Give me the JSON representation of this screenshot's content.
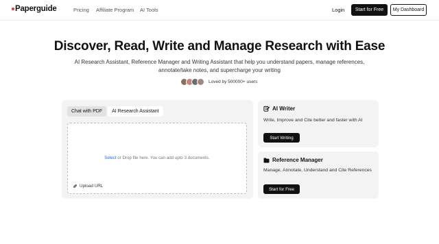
{
  "nav": {
    "logo": "Paperguide",
    "links": [
      "Pricing",
      "Affiliate Program",
      "AI Tools"
    ],
    "login": "Login",
    "start_free": "Start for Free",
    "dashboard": "My Dashboard"
  },
  "hero": {
    "title": "Discover, Read, Write and Manage Research with Ease",
    "subtitle": "AI Research Assistant, Reference Manager and Writing Assistant that help you understand papers, manage references, annotate/take notes, and supercharge your writing",
    "loved": "Loved by 500000+ users"
  },
  "upload_card": {
    "tabs": [
      "Chat with PDF",
      "AI Research Assistant"
    ],
    "select_link": "Select",
    "drop_text": "or Drop file here. You can add upto 3 documents.",
    "upload_url": "Upload URL"
  },
  "ai_writer": {
    "title": "AI Writer",
    "description": "Write, Improve and Cite better and faster with AI",
    "button": "Start Writing"
  },
  "reference_manager": {
    "title": "Reference Manager",
    "description": "Manage, Annotate, Understand and Cite References",
    "button": "Start for Free"
  },
  "colors": {
    "accent_red": "#e53935",
    "dark": "#111111",
    "link_blue": "#2563eb",
    "card_bg": "#f3f3f3"
  }
}
